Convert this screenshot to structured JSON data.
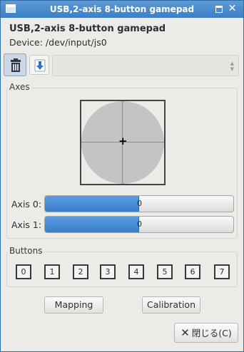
{
  "window": {
    "title": "USB,2-axis 8-button gamepad"
  },
  "device": {
    "name": "USB,2-axis 8-button gamepad",
    "path_label": "Device: /dev/input/js0"
  },
  "toolbar": {
    "delete_icon": "trash-icon",
    "load_icon": "download-arrow-icon",
    "combo_value": ""
  },
  "axes": {
    "label": "Axes",
    "rows": [
      {
        "label": "Axis 0:",
        "value": "0",
        "fill_fraction": 0.5
      },
      {
        "label": "Axis 1:",
        "value": "0",
        "fill_fraction": 0.5
      }
    ]
  },
  "buttons": {
    "label": "Buttons",
    "items": [
      "0",
      "1",
      "2",
      "3",
      "4",
      "5",
      "6",
      "7"
    ]
  },
  "actions": {
    "mapping": "Mapping",
    "calibration": "Calibration",
    "close": "閉じる(C)"
  },
  "colors": {
    "accent": "#3c7fc4",
    "bar_fill": "#4a8fd8"
  }
}
